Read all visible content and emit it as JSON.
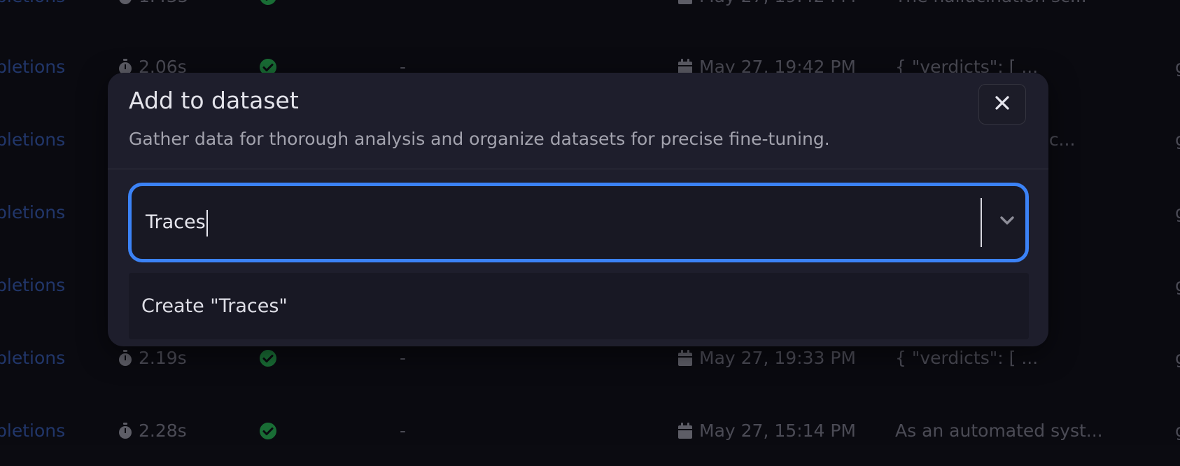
{
  "background_table": {
    "rows": [
      {
        "type": "pletions",
        "duration": "1.435",
        "date": "May 27, 19:42 PM",
        "output": "The hallucination sc..."
      },
      {
        "type": "pletions",
        "duration": "2.06s",
        "dash": "-",
        "date": "May 27, 19:42 PM",
        "output": "{ \"verdicts\": [ ..."
      },
      {
        "type": "pletions",
        "output": "n sc..."
      },
      {
        "type": "pletions"
      },
      {
        "type": "pletions"
      },
      {
        "type": "pletions",
        "duration": "2.19s",
        "dash": "-",
        "date": "May 27, 19:33 PM",
        "output": "{ \"verdicts\": [ ..."
      },
      {
        "type": "pletions",
        "duration": "2.28s",
        "dash": "-",
        "date": "May 27, 15:14 PM",
        "output": "As an automated syst..."
      }
    ],
    "extra_col_glyph": "g"
  },
  "dialog": {
    "title": "Add to dataset",
    "description": "Gather data for thorough analysis and organize datasets for precise fine-tuning.",
    "close_icon": "close-icon"
  },
  "combobox": {
    "value": "Traces",
    "chevron_icon": "chevron-down-icon"
  },
  "dropdown": {
    "options": [
      {
        "label": "Create \"Traces\""
      }
    ]
  },
  "colors": {
    "accent": "#3b82f6",
    "link": "#2f4f9b",
    "success": "#22a34a",
    "dialog_bg": "#1e1e2c",
    "page_bg": "#0c0c12"
  }
}
